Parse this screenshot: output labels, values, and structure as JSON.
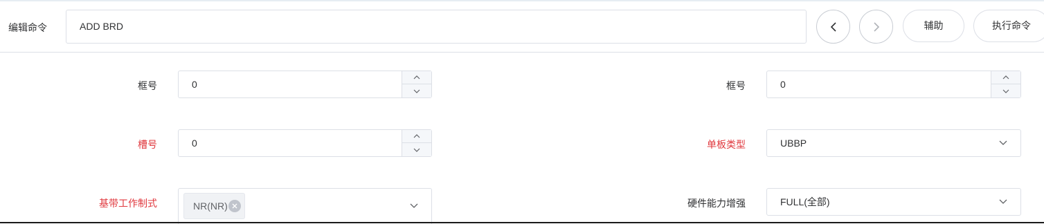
{
  "toolbar": {
    "edit_label": "编辑命令",
    "command_value": "ADD BRD",
    "prev_icon": "chevron-left-icon",
    "next_icon": "chevron-right-icon",
    "assist_label": "辅助",
    "execute_label": "执行命令"
  },
  "form": {
    "frame_left": {
      "label": "框号",
      "value": "0"
    },
    "frame_right": {
      "label": "框号",
      "value": "0"
    },
    "slot": {
      "label": "槽号",
      "value": "0"
    },
    "board_type": {
      "label": "单板类型",
      "value": "UBBP"
    },
    "baseband_mode": {
      "label": "基带工作制式",
      "tag": "NR(NR)"
    },
    "hw_capability": {
      "label": "硬件能力增强",
      "value": "FULL(全部)"
    }
  },
  "colors": {
    "required_label": "#e0383e",
    "border": "#dcdfe6",
    "text": "#303133"
  }
}
